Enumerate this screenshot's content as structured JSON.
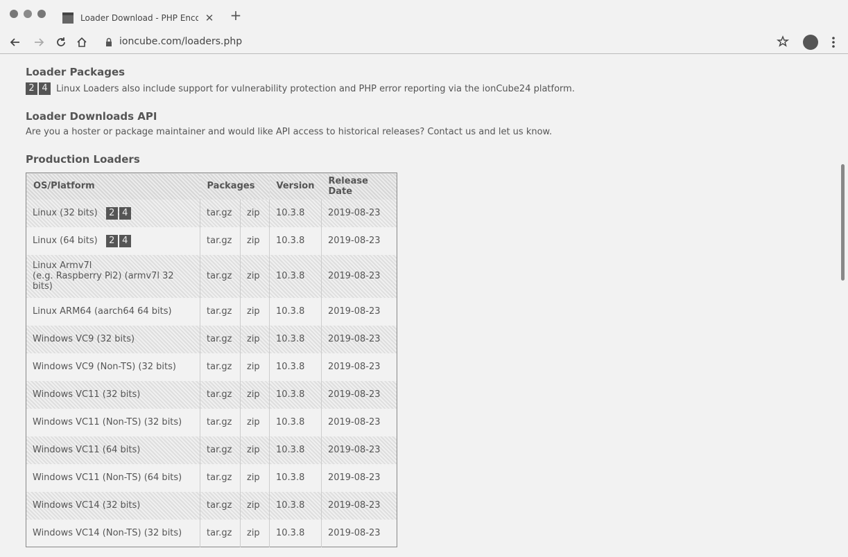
{
  "browser": {
    "tab_title": "Loader Download - PHP Encoder",
    "url": "ioncube.com/loaders.php",
    "new_tab_label": "+"
  },
  "page": {
    "loader_packages": {
      "heading": "Loader Packages",
      "badge": [
        "2",
        "4"
      ],
      "text": "Linux Loaders also include support for vulnerability protection and PHP error reporting via the ionCube24 platform."
    },
    "api": {
      "heading": "Loader Downloads API",
      "text": "Are you a hoster or package maintainer and would like API access to historical releases? Contact us and let us know."
    },
    "production": {
      "heading": "Production Loaders",
      "columns": [
        "OS/Platform",
        "Packages",
        "Version",
        "Release Date"
      ],
      "rows": [
        {
          "os": "Linux (32 bits)",
          "badge": true,
          "tar": "tar.gz",
          "zip": "zip",
          "version": "10.3.8",
          "date": "2019-08-23"
        },
        {
          "os": "Linux (64 bits)",
          "badge": true,
          "tar": "tar.gz",
          "zip": "zip",
          "version": "10.3.8",
          "date": "2019-08-23"
        },
        {
          "os": "Linux Armv7l",
          "os2": "(e.g. Raspberry Pi2) (armv7l 32 bits)",
          "tar": "tar.gz",
          "zip": "zip",
          "version": "10.3.8",
          "date": "2019-08-23"
        },
        {
          "os": "Linux ARM64 (aarch64 64 bits)",
          "tar": "tar.gz",
          "zip": "zip",
          "version": "10.3.8",
          "date": "2019-08-23"
        },
        {
          "os": "Windows VC9 (32 bits)",
          "tar": "tar.gz",
          "zip": "zip",
          "version": "10.3.8",
          "date": "2019-08-23"
        },
        {
          "os": "Windows VC9 (Non-TS) (32 bits)",
          "tar": "tar.gz",
          "zip": "zip",
          "version": "10.3.8",
          "date": "2019-08-23"
        },
        {
          "os": "Windows VC11 (32 bits)",
          "tar": "tar.gz",
          "zip": "zip",
          "version": "10.3.8",
          "date": "2019-08-23"
        },
        {
          "os": "Windows VC11 (Non-TS) (32 bits)",
          "tar": "tar.gz",
          "zip": "zip",
          "version": "10.3.8",
          "date": "2019-08-23"
        },
        {
          "os": "Windows VC11 (64 bits)",
          "tar": "tar.gz",
          "zip": "zip",
          "version": "10.3.8",
          "date": "2019-08-23"
        },
        {
          "os": "Windows VC11 (Non-TS) (64 bits)",
          "tar": "tar.gz",
          "zip": "zip",
          "version": "10.3.8",
          "date": "2019-08-23"
        },
        {
          "os": "Windows VC14 (32 bits)",
          "tar": "tar.gz",
          "zip": "zip",
          "version": "10.3.8",
          "date": "2019-08-23"
        },
        {
          "os": "Windows VC14 (Non-TS) (32 bits)",
          "tar": "tar.gz",
          "zip": "zip",
          "version": "10.3.8",
          "date": "2019-08-23"
        }
      ]
    }
  }
}
